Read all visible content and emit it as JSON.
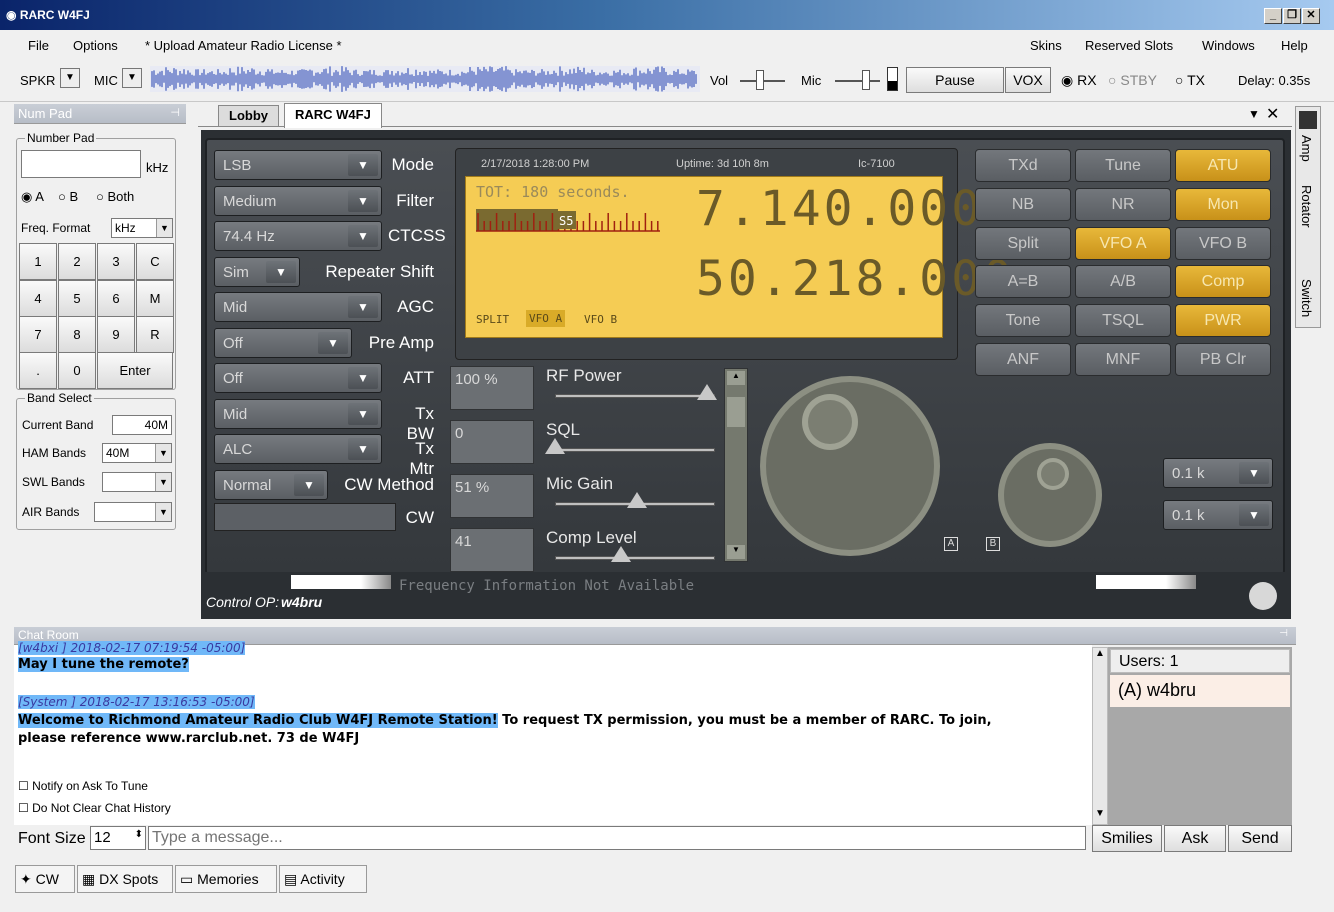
{
  "window": {
    "title": "RARC W4FJ",
    "min": "_",
    "max": "❐",
    "close": "✕"
  },
  "menu": {
    "file": "File",
    "options": "Options",
    "upload": "* Upload Amateur Radio License *",
    "skins": "Skins",
    "reserved": "Reserved Slots",
    "windows": "Windows",
    "help": "Help"
  },
  "toolbar": {
    "spkr": "SPKR",
    "mic": "MIC",
    "vol": "Vol",
    "mic2": "Mic",
    "pause": "Pause",
    "vox": "VOX",
    "rx": "RX",
    "stby": "STBY",
    "tx": "TX",
    "delay": "Delay: 0.35s"
  },
  "numpad": {
    "panel_title": "Num Pad",
    "group": "Number Pad",
    "unit": "kHz",
    "radio_a": "A",
    "radio_b": "B",
    "radio_both": "Both",
    "freq_format_label": "Freq. Format",
    "freq_format_value": "kHz",
    "keys": [
      "1",
      "2",
      "3",
      "C",
      "4",
      "5",
      "6",
      "M",
      "7",
      "8",
      "9",
      "R",
      ".",
      "0",
      "Enter"
    ],
    "band_group": "Band Select",
    "current_band_label": "Current Band",
    "current_band_value": "40M",
    "ham_label": "HAM Bands",
    "ham_value": "40M",
    "swl_label": "SWL Bands",
    "air_label": "AIR Bands"
  },
  "tabs": {
    "lobby": "Lobby",
    "station": "RARC W4FJ"
  },
  "rig": {
    "dropdowns": [
      {
        "value": "LSB",
        "label": "Mode"
      },
      {
        "value": "Medium",
        "label": "Filter"
      },
      {
        "value": "74.4 Hz",
        "label": "CTCSS"
      },
      {
        "value": "Sim",
        "label": "Repeater Shift"
      },
      {
        "value": "Mid",
        "label": "AGC"
      },
      {
        "value": "Off",
        "label": "Pre Amp"
      },
      {
        "value": "Off",
        "label": "ATT"
      },
      {
        "value": "Mid",
        "label": "Tx BW"
      },
      {
        "value": "ALC",
        "label": "Tx Mtr"
      },
      {
        "value": "Normal",
        "label": "CW Method"
      }
    ],
    "cw_label": "CW",
    "lcd": {
      "date": "2/17/2018 1:28:00 PM",
      "uptime": "Uptime: 3d 10h 8m",
      "model": "Ic-7100",
      "tot": "TOT: 180 seconds.",
      "freq_a": "7.140.000",
      "freq_b": "50.218.000",
      "meter_label": "S5",
      "split": "SPLIT",
      "vfoa": "VFO A",
      "vfob": "VFO B"
    },
    "sliders": [
      {
        "value": "100 %",
        "label": "RF Power",
        "level": 0.95
      },
      {
        "value": "0",
        "label": "SQL",
        "level": 0.0
      },
      {
        "value": "51 %",
        "label": "Mic Gain",
        "level": 0.51
      },
      {
        "value": "41",
        "label": "Comp Level",
        "level": 0.41
      }
    ],
    "buttons": [
      {
        "label": "TXd",
        "on": false
      },
      {
        "label": "Tune",
        "on": false
      },
      {
        "label": "ATU",
        "on": true
      },
      {
        "label": "NB",
        "on": false
      },
      {
        "label": "NR",
        "on": false
      },
      {
        "label": "Mon",
        "on": true
      },
      {
        "label": "Split",
        "on": false
      },
      {
        "label": "VFO A",
        "on": true
      },
      {
        "label": "VFO B",
        "on": false
      },
      {
        "label": "A=B",
        "on": false
      },
      {
        "label": "A/B",
        "on": false
      },
      {
        "label": "Comp",
        "on": true
      },
      {
        "label": "Tone",
        "on": false
      },
      {
        "label": "TSQL",
        "on": false
      },
      {
        "label": "PWR",
        "on": true
      },
      {
        "label": "ANF",
        "on": false
      },
      {
        "label": "MNF",
        "on": false
      },
      {
        "label": "PB Clr",
        "on": false
      }
    ],
    "step1": "0.1 k",
    "step2": "0.1 k",
    "knob_a": "A",
    "knob_b": "B",
    "freq_info": "Frequency Information Not Available",
    "control_op_label": "Control OP:",
    "control_op": "w4bru"
  },
  "side_tabs": {
    "amp": "Amp",
    "rotator": "Rotator",
    "switch": "Switch"
  },
  "chat": {
    "panel_title": "Chat Room",
    "msg1_head": "[w4bxi ] 2018-02-17 07:19:54 -05:00]",
    "msg1_body": "May I tune the remote?",
    "msg2_head": "[System ] 2018-02-17 13:16:53 -05:00]",
    "msg2_body_hl": "Welcome to Richmond Amateur Radio Club W4FJ Remote Station!",
    "msg2_body_rest": " To request TX permission, you must be a member of RARC. To join,",
    "msg2_body2": "please reference www.rarclub.net. 73 de W4FJ",
    "notify": "Notify on Ask To Tune",
    "noclear": "Do Not Clear Chat History",
    "font_label": "Font Size",
    "font_value": "12",
    "placeholder": "Type a message...",
    "smilies": "Smilies",
    "ask": "Ask",
    "send": "Send",
    "users_header": "Users: 1",
    "user1": "(A) w4bru"
  },
  "bottom_tabs": [
    "CW",
    "DX Spots",
    "Memories",
    "Activity"
  ]
}
